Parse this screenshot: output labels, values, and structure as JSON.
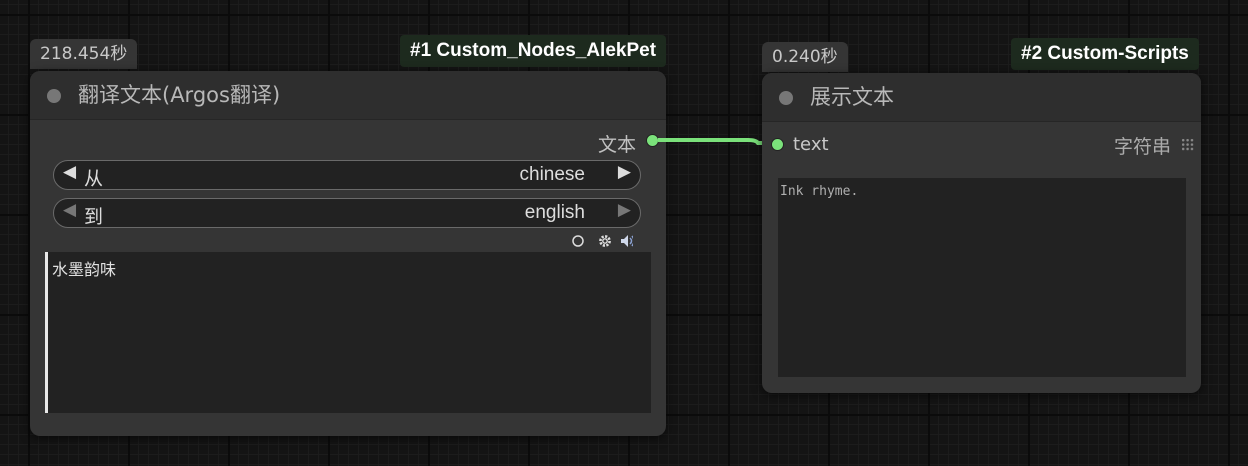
{
  "node1": {
    "time_badge": "218.454秒",
    "pack_badge": "#1 Custom_Nodes_AlekPet",
    "title": "翻译文本(Argos翻译)",
    "output_label": "文本",
    "combo_from": {
      "label": "从",
      "value": "chinese"
    },
    "combo_to": {
      "label": "到",
      "value": "english"
    },
    "text_value": "水墨韵味",
    "tool_icons": [
      "circle-icon",
      "gear-icon",
      "speaker-icon"
    ]
  },
  "node2": {
    "time_badge": "0.240秒",
    "pack_badge": "#2 Custom-Scripts",
    "title": "展示文本",
    "input_label": "text",
    "input_type": "字符串",
    "display_value": "Ink rhyme."
  },
  "colors": {
    "link": "#7be27b",
    "canvas": "#141414",
    "node_body": "#353535",
    "pack_badge_bg": "#1d2a1e"
  }
}
